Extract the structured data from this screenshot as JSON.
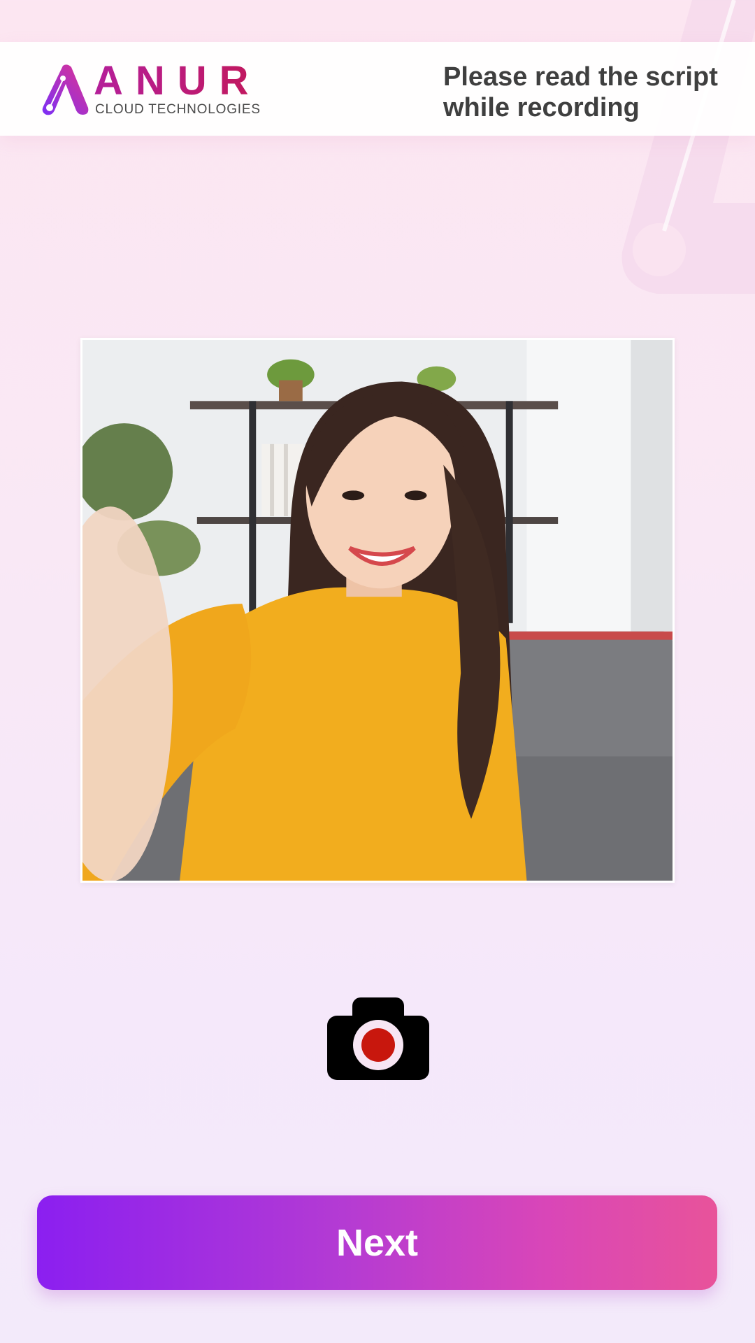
{
  "header": {
    "brand_name": "ANUR",
    "brand_tagline": "CLOUD TECHNOLOGIES",
    "instruction": "Please read the script while recording"
  },
  "preview": {
    "description_icon": "camera-preview-image"
  },
  "controls": {
    "record_icon": "camera-record-icon",
    "next_label": "Next"
  },
  "colors": {
    "brand_magenta": "#b41f9a",
    "button_gradient_start": "#8b1ff0",
    "button_gradient_end": "#e8539a",
    "record_red": "#c8170d"
  }
}
